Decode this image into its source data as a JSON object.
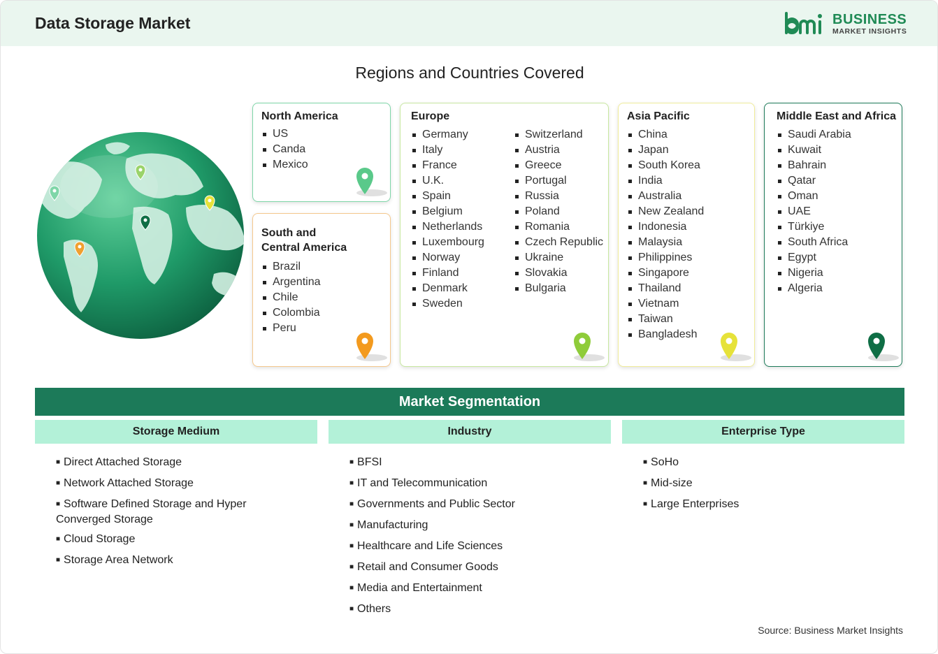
{
  "header": {
    "title": "Data Storage Market"
  },
  "logo": {
    "line1": "BUSINESS",
    "line2": "MARKET INSIGHTS"
  },
  "regions_title": "Regions and Countries Covered",
  "regions": {
    "north_america": {
      "title": "North America",
      "countries": [
        "US",
        "Canda",
        "Mexico"
      ]
    },
    "south_america": {
      "title_line1": "South and",
      "title_line2": "Central America",
      "countries": [
        "Brazil",
        "Argentina",
        "Chile",
        "Colombia",
        "Peru"
      ]
    },
    "europe": {
      "title": "Europe",
      "col1": [
        "Germany",
        "Italy",
        "France",
        "U.K.",
        "Spain",
        "Belgium",
        "Netherlands",
        "Luxembourg",
        "Norway",
        "Finland",
        "Denmark",
        "Sweden"
      ],
      "col2": [
        "Switzerland",
        "Austria",
        "Greece",
        "Portugal",
        "Russia",
        "Poland",
        "Romania",
        "Czech Republic",
        "Ukraine",
        "Slovakia",
        "Bulgaria"
      ]
    },
    "asia_pacific": {
      "title": "Asia Pacific",
      "countries": [
        "China",
        "Japan",
        "South Korea",
        "India",
        "Australia",
        "New Zealand",
        "Indonesia",
        "Malaysia",
        "Philippines",
        "Singapore",
        "Thailand",
        "Vietnam",
        "Taiwan",
        "Bangladesh"
      ]
    },
    "mea": {
      "title": "Middle East and Africa",
      "countries": [
        "Saudi Arabia",
        "Kuwait",
        "Bahrain",
        "Qatar",
        "Oman",
        "UAE",
        "Türkiye",
        "South Africa",
        "Egypt",
        "Nigeria",
        "Algeria"
      ]
    }
  },
  "segmentation": {
    "title": "Market Segmentation",
    "storage_medium": {
      "title": "Storage Medium",
      "items": [
        "Direct Attached Storage",
        "Network Attached Storage",
        "Software Defined Storage and Hyper Converged Storage",
        "Cloud Storage",
        "Storage Area Network"
      ]
    },
    "industry": {
      "title": "Industry",
      "items": [
        "BFSI",
        "IT and Telecommunication",
        "Governments and Public Sector",
        "Manufacturing",
        "Healthcare and Life Sciences",
        "Retail and Consumer Goods",
        "Media and Entertainment",
        "Others"
      ]
    },
    "enterprise_type": {
      "title": "Enterprise Type",
      "items": [
        "SoHo",
        "Mid-size",
        "Large Enterprises"
      ]
    }
  },
  "source": "Source: Business Market Insights",
  "colors": {
    "brand_green": "#1c7a59",
    "header_bg": "#eaf6ef",
    "segment_head_bg": "#b3f1d8",
    "north_america_border": "#7fd6a8",
    "south_america_border": "#f5c88d",
    "europe_border": "#c8e7a0",
    "asia_pacific_border": "#f0ec9a",
    "mea_border": "#1c7a59"
  }
}
